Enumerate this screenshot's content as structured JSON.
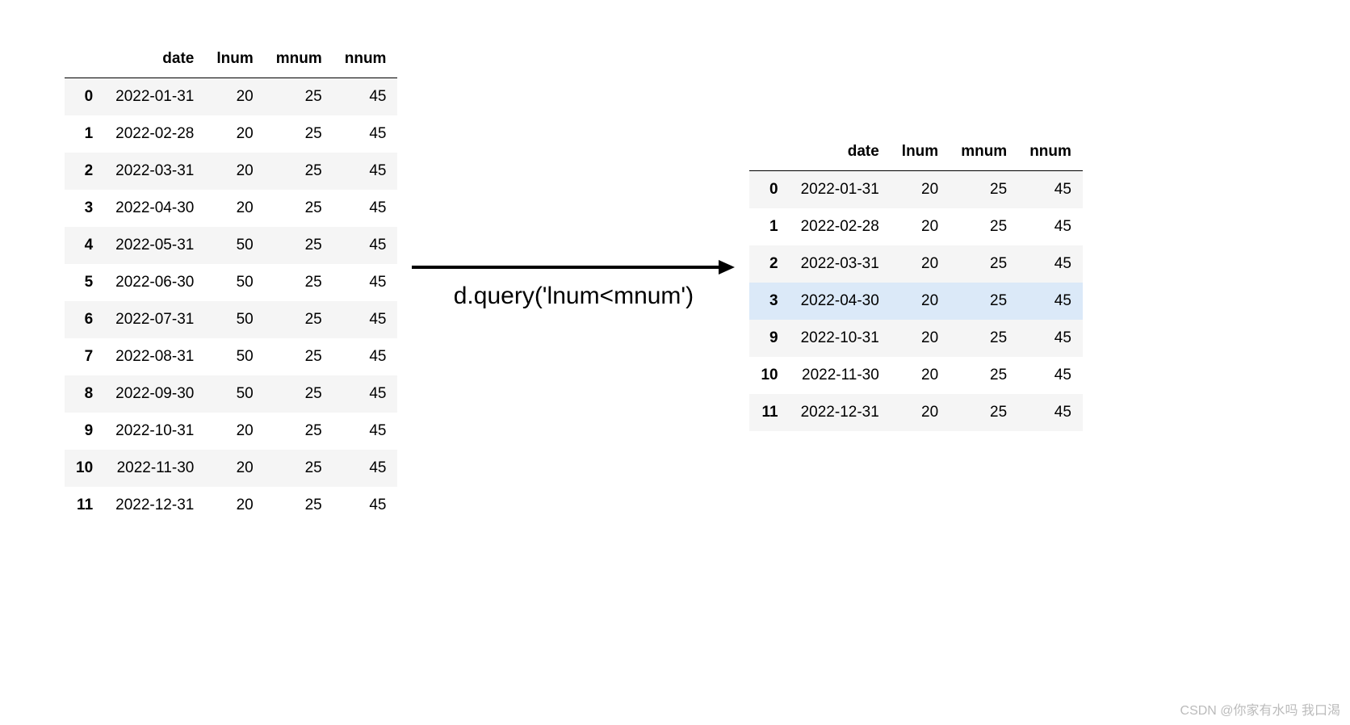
{
  "left_table": {
    "columns": [
      "date",
      "lnum",
      "mnum",
      "nnum"
    ],
    "index": [
      "0",
      "1",
      "2",
      "3",
      "4",
      "5",
      "6",
      "7",
      "8",
      "9",
      "10",
      "11"
    ],
    "rows": [
      [
        "2022-01-31",
        "20",
        "25",
        "45"
      ],
      [
        "2022-02-28",
        "20",
        "25",
        "45"
      ],
      [
        "2022-03-31",
        "20",
        "25",
        "45"
      ],
      [
        "2022-04-30",
        "20",
        "25",
        "45"
      ],
      [
        "2022-05-31",
        "50",
        "25",
        "45"
      ],
      [
        "2022-06-30",
        "50",
        "25",
        "45"
      ],
      [
        "2022-07-31",
        "50",
        "25",
        "45"
      ],
      [
        "2022-08-31",
        "50",
        "25",
        "45"
      ],
      [
        "2022-09-30",
        "50",
        "25",
        "45"
      ],
      [
        "2022-10-31",
        "20",
        "25",
        "45"
      ],
      [
        "2022-11-30",
        "20",
        "25",
        "45"
      ],
      [
        "2022-12-31",
        "20",
        "25",
        "45"
      ]
    ],
    "stripe_even_indices": [
      0,
      2,
      4,
      6,
      8,
      10
    ]
  },
  "right_table": {
    "columns": [
      "date",
      "lnum",
      "mnum",
      "nnum"
    ],
    "index": [
      "0",
      "1",
      "2",
      "3",
      "9",
      "10",
      "11"
    ],
    "rows": [
      [
        "2022-01-31",
        "20",
        "25",
        "45"
      ],
      [
        "2022-02-28",
        "20",
        "25",
        "45"
      ],
      [
        "2022-03-31",
        "20",
        "25",
        "45"
      ],
      [
        "2022-04-30",
        "20",
        "25",
        "45"
      ],
      [
        "2022-10-31",
        "20",
        "25",
        "45"
      ],
      [
        "2022-11-30",
        "20",
        "25",
        "45"
      ],
      [
        "2022-12-31",
        "20",
        "25",
        "45"
      ]
    ],
    "stripe_even_indices": [
      0,
      2,
      4,
      6
    ],
    "highlight_row": 3
  },
  "query_text": "d.query('lnum<mnum')",
  "watermark": "CSDN @你家有水吗 我口渴"
}
